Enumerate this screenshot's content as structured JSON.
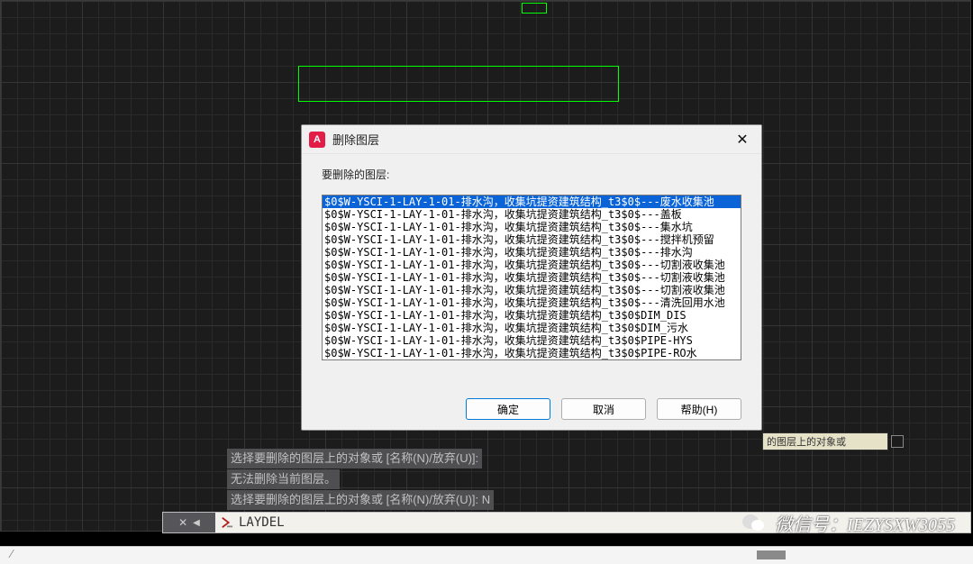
{
  "dialog": {
    "title": "删除图层",
    "prompt": "要删除的图层:",
    "items": [
      "$0$W-YSCI-1-LAY-1-01-排水沟，收集坑提资建筑结构_t3$0$---废水收集池",
      "$0$W-YSCI-1-LAY-1-01-排水沟，收集坑提资建筑结构_t3$0$---盖板",
      "$0$W-YSCI-1-LAY-1-01-排水沟，收集坑提资建筑结构_t3$0$---集水坑",
      "$0$W-YSCI-1-LAY-1-01-排水沟，收集坑提资建筑结构_t3$0$---搅拌机预留",
      "$0$W-YSCI-1-LAY-1-01-排水沟，收集坑提资建筑结构_t3$0$---排水沟",
      "$0$W-YSCI-1-LAY-1-01-排水沟，收集坑提资建筑结构_t3$0$---切割液收集池",
      "$0$W-YSCI-1-LAY-1-01-排水沟，收集坑提资建筑结构_t3$0$---切割液收集池",
      "$0$W-YSCI-1-LAY-1-01-排水沟，收集坑提资建筑结构_t3$0$---切割液收集池",
      "$0$W-YSCI-1-LAY-1-01-排水沟，收集坑提资建筑结构_t3$0$---清洗回用水池",
      "$0$W-YSCI-1-LAY-1-01-排水沟，收集坑提资建筑结构_t3$0$DIM_DIS",
      "$0$W-YSCI-1-LAY-1-01-排水沟，收集坑提资建筑结构_t3$0$DIM_污水",
      "$0$W-YSCI-1-LAY-1-01-排水沟，收集坑提资建筑结构_t3$0$PIPE-HYS",
      "$0$W-YSCI-1-LAY-1-01-排水沟，收集坑提资建筑结构_t3$0$PIPE-RO水"
    ],
    "selected_index": 0,
    "buttons": {
      "ok": "确定",
      "cancel": "取消",
      "help": "帮助(H)"
    }
  },
  "tooltip_remnant": "的图层上的对象或",
  "history": {
    "l1": "选择要删除的图层上的对象或 [名称(N)/放弃(U)]:",
    "l2": "无法删除当前图层。",
    "l3": "选择要删除的图层上的对象或 [名称(N)/放弃(U)]: N"
  },
  "command_input": "LAYDEL",
  "wechat_label": "微信号：IEZYSXW3055",
  "app_icon_letter": "A"
}
